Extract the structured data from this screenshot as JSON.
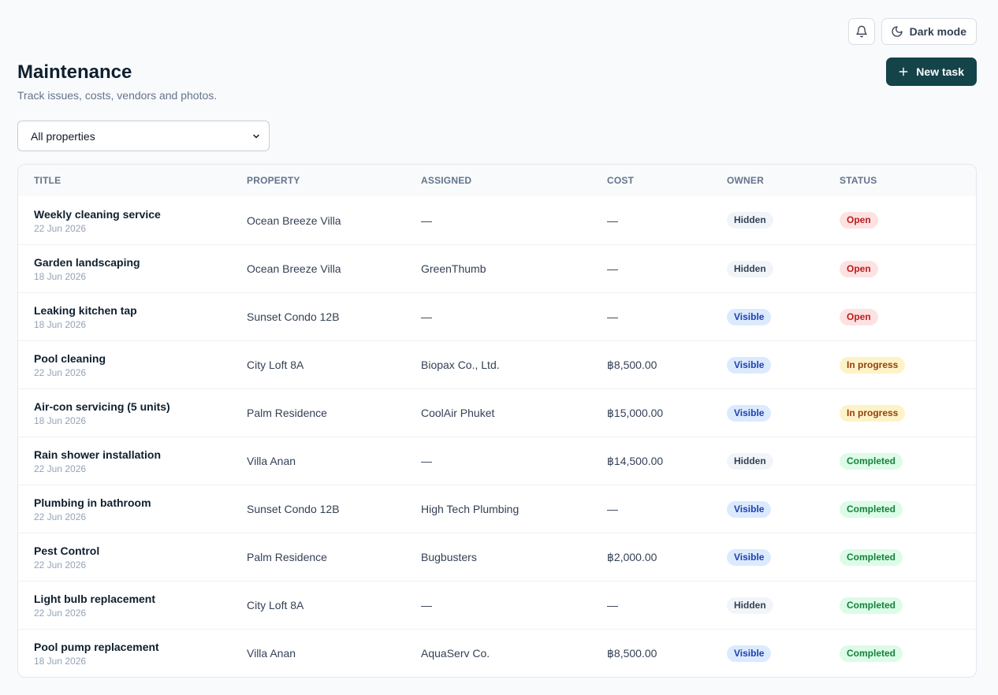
{
  "topbar": {
    "bell_icon": "bell-icon",
    "dark_mode_icon": "moon-icon",
    "dark_mode_label": "Dark mode"
  },
  "header": {
    "title": "Maintenance",
    "subtitle": "Track issues, costs, vendors and photos.",
    "new_task_label": "New task",
    "new_task_icon": "plus-icon",
    "accent_color": "#14434a"
  },
  "filter": {
    "selected": "All properties"
  },
  "table": {
    "columns": [
      "TITLE",
      "PROPERTY",
      "ASSIGNED",
      "COST",
      "OWNER",
      "STATUS"
    ],
    "rows": [
      {
        "title": "Weekly cleaning service",
        "date": "22 Jun 2026",
        "property": "Ocean Breeze Villa",
        "assigned": "—",
        "cost": "—",
        "owner": "Hidden",
        "status": "Open"
      },
      {
        "title": "Garden landscaping",
        "date": "18 Jun 2026",
        "property": "Ocean Breeze Villa",
        "assigned": "GreenThumb",
        "cost": "—",
        "owner": "Hidden",
        "status": "Open"
      },
      {
        "title": "Leaking kitchen tap",
        "date": "18 Jun 2026",
        "property": "Sunset Condo 12B",
        "assigned": "—",
        "cost": "—",
        "owner": "Visible",
        "status": "Open"
      },
      {
        "title": "Pool cleaning",
        "date": "22 Jun 2026",
        "property": "City Loft 8A",
        "assigned": "Biopax Co., Ltd.",
        "cost": "฿8,500.00",
        "owner": "Visible",
        "status": "In progress"
      },
      {
        "title": "Air-con servicing (5 units)",
        "date": "18 Jun 2026",
        "property": "Palm Residence",
        "assigned": "CoolAir Phuket",
        "cost": "฿15,000.00",
        "owner": "Visible",
        "status": "In progress"
      },
      {
        "title": "Rain shower installation",
        "date": "22 Jun 2026",
        "property": "Villa Anan",
        "assigned": "—",
        "cost": "฿14,500.00",
        "owner": "Hidden",
        "status": "Completed"
      },
      {
        "title": "Plumbing in bathroom",
        "date": "22 Jun 2026",
        "property": "Sunset Condo 12B",
        "assigned": "High Tech Plumbing",
        "cost": "—",
        "owner": "Visible",
        "status": "Completed"
      },
      {
        "title": "Pest Control",
        "date": "22 Jun 2026",
        "property": "Palm Residence",
        "assigned": "Bugbusters",
        "cost": "฿2,000.00",
        "owner": "Visible",
        "status": "Completed"
      },
      {
        "title": "Light bulb replacement",
        "date": "22 Jun 2026",
        "property": "City Loft 8A",
        "assigned": "—",
        "cost": "—",
        "owner": "Hidden",
        "status": "Completed"
      },
      {
        "title": "Pool pump replacement",
        "date": "18 Jun 2026",
        "property": "Villa Anan",
        "assigned": "AquaServ Co.",
        "cost": "฿8,500.00",
        "owner": "Visible",
        "status": "Completed"
      }
    ]
  }
}
